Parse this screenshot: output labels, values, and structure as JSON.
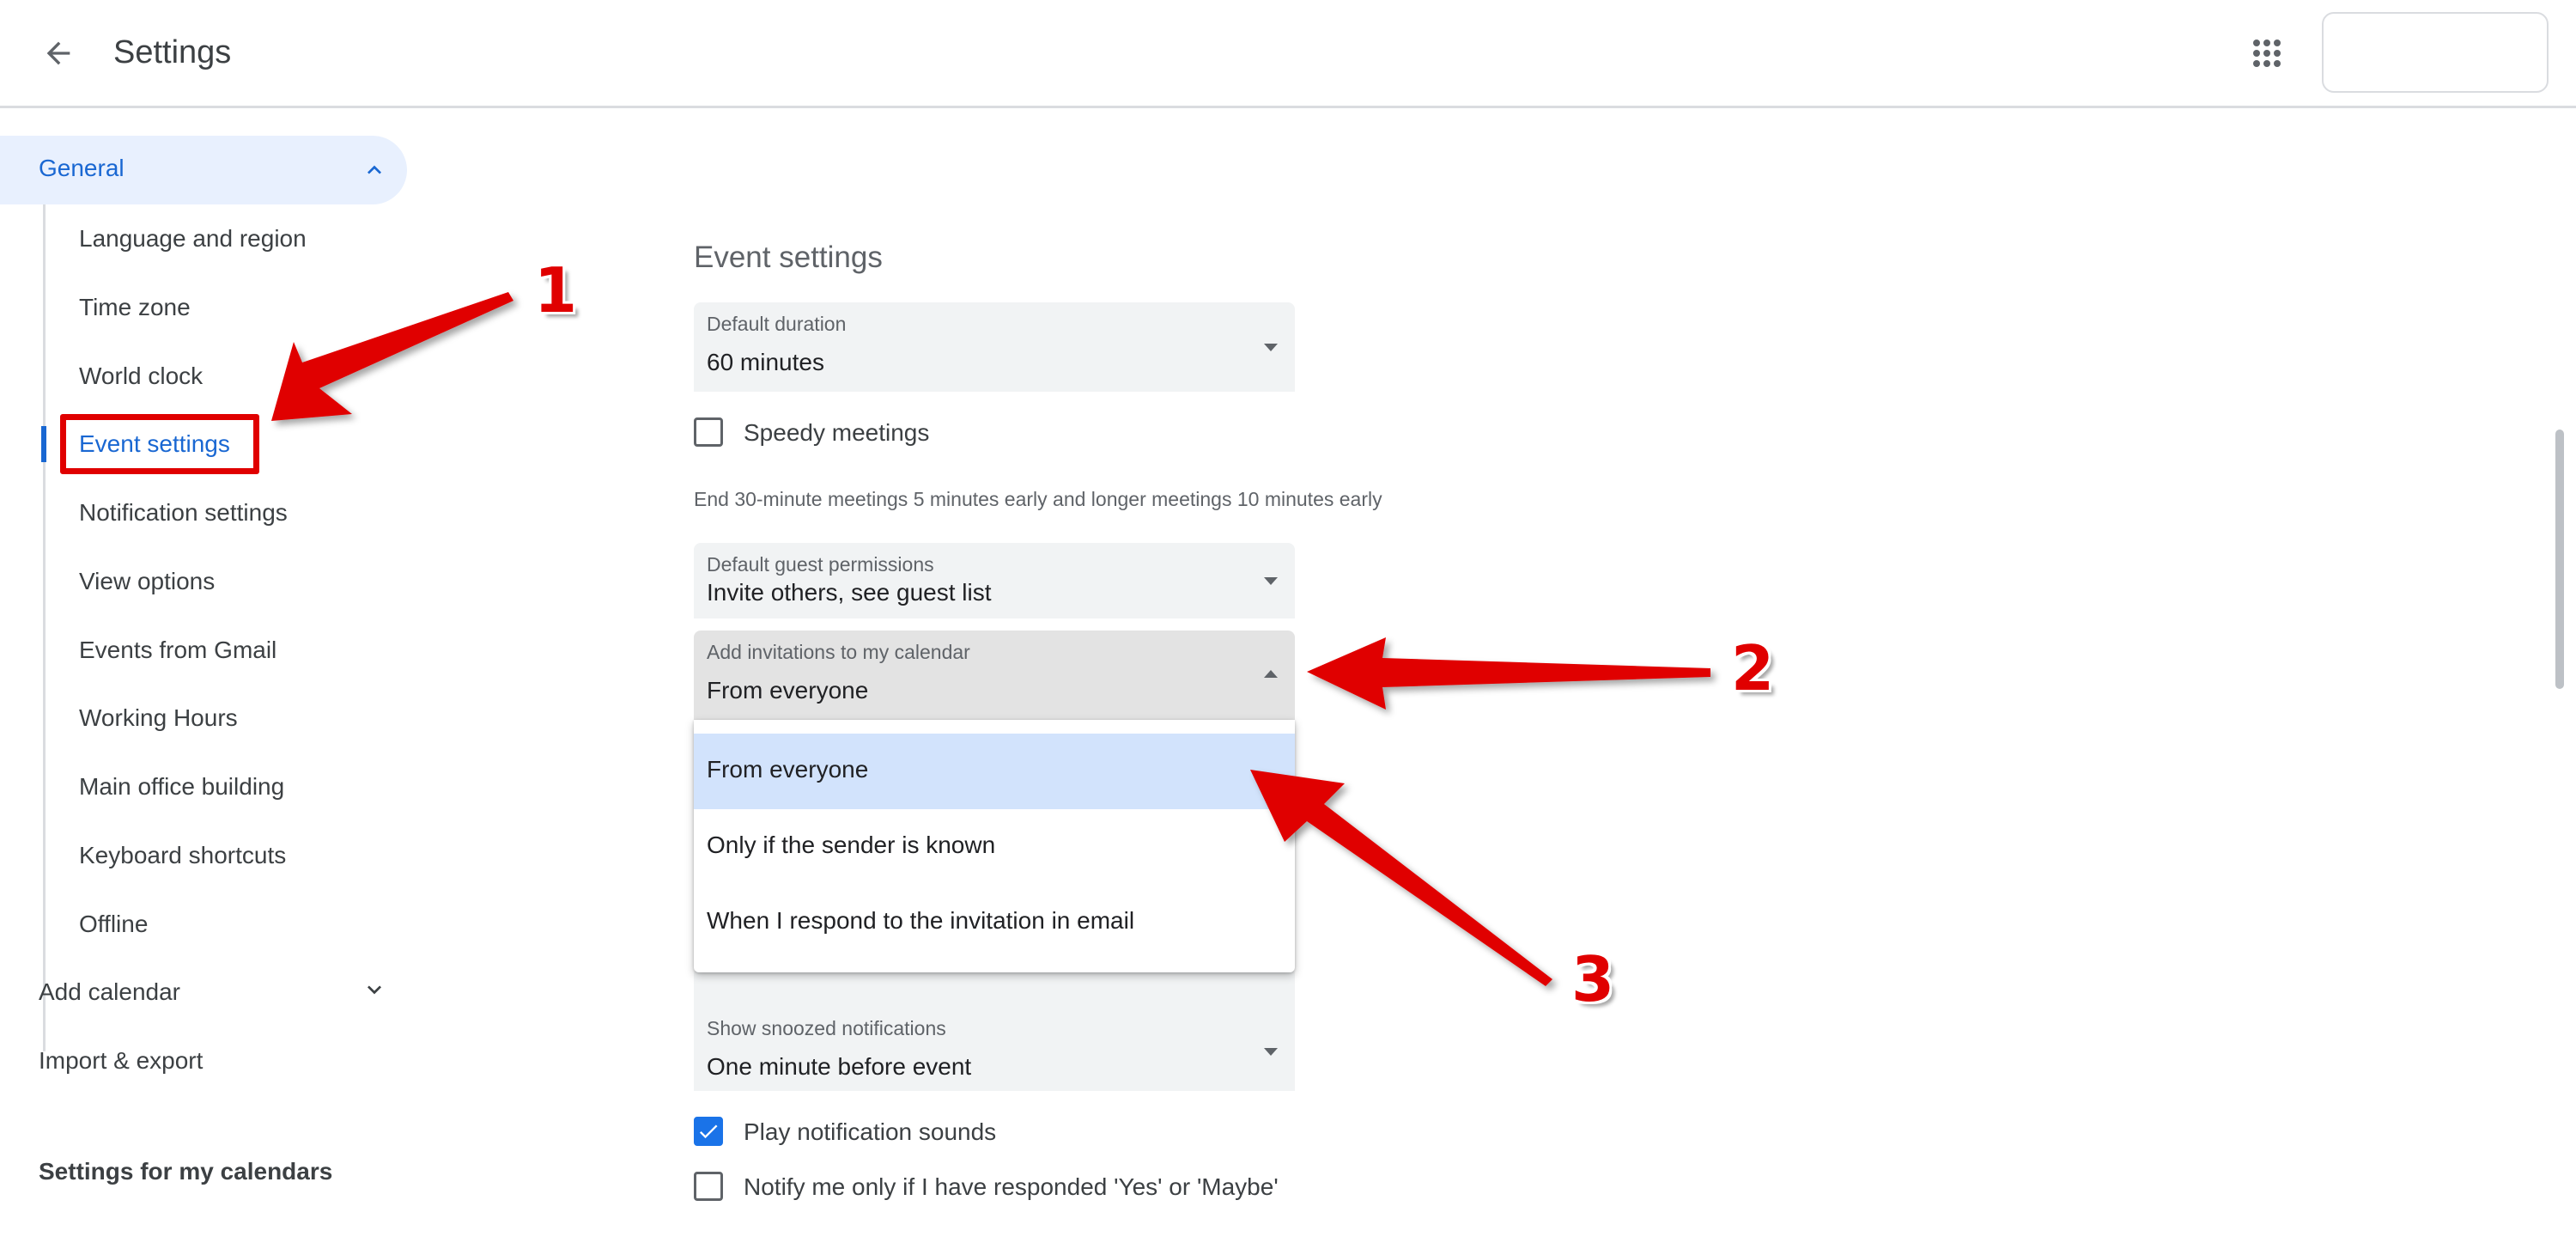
{
  "header": {
    "title": "Settings"
  },
  "icons": {
    "back": "arrow-left-icon",
    "apps": "apps-grid-icon",
    "chevron_up": "chevron-up-icon",
    "chevron_down": "chevron-down-icon",
    "check": "check-icon"
  },
  "sidebar": {
    "general_label": "General",
    "sub_items": [
      "Language and region",
      "Time zone",
      "World clock",
      "Event settings",
      "Notification settings",
      "View options",
      "Events from Gmail",
      "Working Hours",
      "Main office building",
      "Keyboard shortcuts",
      "Offline"
    ],
    "active_item": "Event settings",
    "add_calendar": "Add calendar",
    "import_export": "Import & export",
    "settings_for_my_calendars": "Settings for my calendars"
  },
  "main": {
    "section_title": "Event settings",
    "default_duration": {
      "label": "Default duration",
      "value": "60 minutes"
    },
    "speedy_meetings": {
      "label": "Speedy meetings",
      "checked": false
    },
    "speedy_helper": "End 30-minute meetings 5 minutes early and longer meetings 10 minutes early",
    "guest_permissions": {
      "label": "Default guest permissions",
      "value": "Invite others, see guest list"
    },
    "add_invitations": {
      "label": "Add invitations to my calendar",
      "value": "From everyone",
      "options": [
        "From everyone",
        "Only if the sender is known",
        "When I respond to the invitation in email"
      ],
      "highlighted": "From everyone"
    },
    "snoozed_notifications": {
      "label": "Show snoozed notifications",
      "value": "One minute before event"
    },
    "play_sounds": {
      "label": "Play notification sounds",
      "checked": true
    },
    "notify_responded": {
      "label": "Notify me only if I have responded 'Yes' or 'Maybe'",
      "checked": false
    }
  },
  "annotations": {
    "step1": "1",
    "step2": "2",
    "step3": "3",
    "color": "#e00000"
  },
  "colors": {
    "accent": "#1967d2",
    "active_bg": "#e8f0fe",
    "selected_option_bg": "#d2e3fc",
    "checkbox_checked": "#1a73e8",
    "field_bg": "#f1f3f4"
  }
}
